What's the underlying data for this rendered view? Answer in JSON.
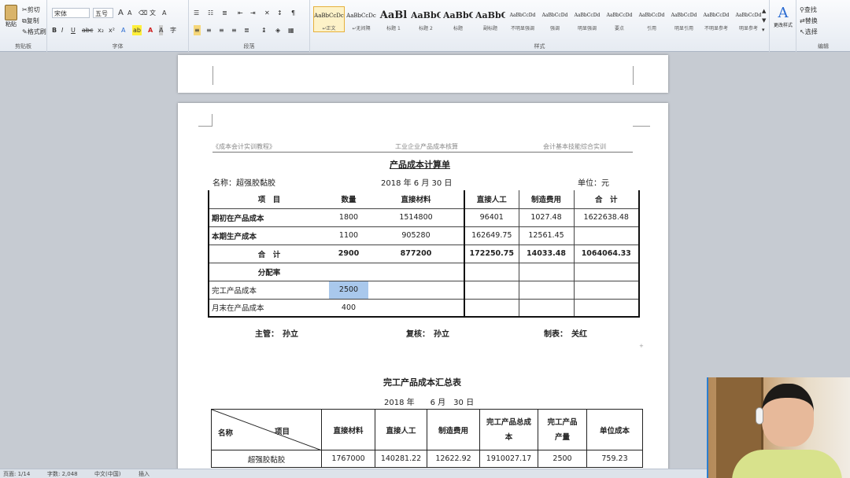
{
  "ribbon": {
    "clipboard": {
      "paste": "粘贴",
      "cut": "剪切",
      "copy": "复制",
      "format": "格式刷",
      "label": "剪贴板"
    },
    "font": {
      "name": "宋体",
      "size": "五号",
      "grow": "A",
      "shrink": "A",
      "label": "字体"
    },
    "paragraph": {
      "label": "段落"
    },
    "styles": {
      "label": "样式",
      "items": [
        {
          "preview": "AaBbCcDc",
          "name": "↵正文"
        },
        {
          "preview": "AaBbCcDc",
          "name": "↵无间隔"
        },
        {
          "preview": "AaBl",
          "name": "标题 1"
        },
        {
          "preview": "AaBbC",
          "name": "标题 2"
        },
        {
          "preview": "AaBbC",
          "name": "标题"
        },
        {
          "preview": "AaBbC",
          "name": "副标题"
        },
        {
          "preview": "AaBbCcDd",
          "name": "不明显强调"
        },
        {
          "preview": "AaBbCcDd",
          "name": "强调"
        },
        {
          "preview": "AaBbCcDd",
          "name": "明显强调"
        },
        {
          "preview": "AaBbCcDd",
          "name": "要点"
        },
        {
          "preview": "AaBbCcDd",
          "name": "引用"
        },
        {
          "preview": "AaBbCcDd",
          "name": "明显引用"
        },
        {
          "preview": "AaBbCcDd",
          "name": "不明显参考"
        },
        {
          "preview": "AaBbCcDd",
          "name": "明显参考"
        }
      ]
    },
    "change_styles": "更改样式",
    "editing": {
      "find": "查找",
      "replace": "替换",
      "select": "选择",
      "label": "编辑"
    }
  },
  "doc1": {
    "header_left": "《成本会计实训教程》",
    "header_mid": "工业企业产品成本核算",
    "header_right": "会计基本技能综合实训",
    "title": "产品成本计算单",
    "name_label": "名称：超强胶黏胶",
    "date": "2018 年 6 月 30 日",
    "unit": "单位：元",
    "table": {
      "headers": [
        "项　目",
        "数量",
        "直接材料",
        "直接人工",
        "制造费用",
        "合　计"
      ],
      "rows": [
        [
          "期初在产品成本",
          "1800",
          "1514800",
          "96401",
          "1027.48",
          "1622638.48"
        ],
        [
          "本期生产成本",
          "1100",
          "905280",
          "162649.75",
          "12561.45",
          ""
        ],
        [
          "合　计",
          "2900",
          "877200",
          "172250.75",
          "14033.48",
          "1064064.33"
        ],
        [
          "分配率",
          "",
          "",
          "",
          "",
          ""
        ],
        [
          "完工产品成本",
          "2500",
          "",
          "",
          "",
          ""
        ],
        [
          "月末在产品成本",
          "400",
          "",
          "",
          "",
          ""
        ]
      ]
    },
    "footer": {
      "supervisor": "主管：　孙立",
      "reviewer": "复核：　孙立",
      "preparer": "制表：　关红"
    }
  },
  "doc2": {
    "title": "完工产品成本汇总表",
    "date": "2018 年　　6 月　30 日",
    "diag_name": "名称",
    "diag_item": "项目",
    "headers": [
      "直接材料",
      "直接人工",
      "制造费用",
      "完工产品总成本",
      "完工产品产量",
      "单位成本"
    ],
    "row": [
      "超强胶黏胶",
      "1767000",
      "140281.22",
      "12622.92",
      "1910027.17",
      "2500",
      "759.23"
    ]
  },
  "statusbar": {
    "page": "页面: 1/14",
    "words": "字数: 2,048",
    "lang": "中文(中国)",
    "mode": "插入"
  }
}
